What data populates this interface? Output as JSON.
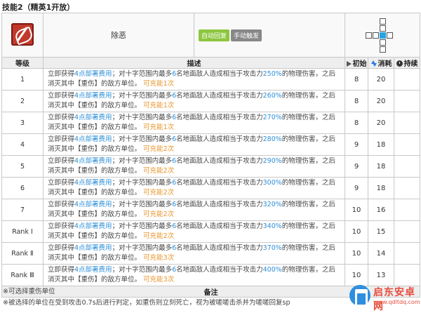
{
  "title": "技能2（精英1开放）",
  "skill": {
    "name": "除恶",
    "tags": [
      "自动回复",
      "手动触发"
    ],
    "colors": {
      "auto_tag": "#8dc63f",
      "manual_tag": "#888888",
      "highlight_blue": "#2f8fd8",
      "highlight_orange": "#e8952d"
    }
  },
  "headers": {
    "level": "等级",
    "desc": "描述",
    "init": "初始",
    "cost": "消耗",
    "dur": "持续"
  },
  "desc_text": {
    "p1": "立即获得",
    "dp": "4点部署费用",
    "p2": "；对十字范围内最多",
    "count": "6",
    "p3": "名地面敌人造成相当于攻击力",
    "p4": "的物理伤害，之后消灭其中【重伤】的敌方单位。",
    "charges_prefix": "可充能"
  },
  "levels": [
    {
      "level": "1",
      "pct": "250%",
      "charges": "1次",
      "init": "8",
      "cost": "20",
      "dur": ""
    },
    {
      "level": "2",
      "pct": "260%",
      "charges": "1次",
      "init": "8",
      "cost": "20",
      "dur": ""
    },
    {
      "level": "3",
      "pct": "270%",
      "charges": "1次",
      "init": "8",
      "cost": "20",
      "dur": ""
    },
    {
      "level": "4",
      "pct": "280%",
      "charges": "2次",
      "init": "9",
      "cost": "18",
      "dur": ""
    },
    {
      "level": "5",
      "pct": "290%",
      "charges": "2次",
      "init": "9",
      "cost": "18",
      "dur": ""
    },
    {
      "level": "6",
      "pct": "300%",
      "charges": "2次",
      "init": "9",
      "cost": "18",
      "dur": ""
    },
    {
      "level": "7",
      "pct": "320%",
      "charges": "2次",
      "init": "10",
      "cost": "16",
      "dur": ""
    },
    {
      "level": "Rank Ⅰ",
      "pct": "340%",
      "charges": "2次",
      "init": "10",
      "cost": "15",
      "dur": ""
    },
    {
      "level": "Rank Ⅱ",
      "pct": "370%",
      "charges": "3次",
      "init": "10",
      "cost": "14",
      "dur": ""
    },
    {
      "level": "Rank Ⅲ",
      "pct": "400%",
      "charges": "3次",
      "init": "10",
      "cost": "13",
      "dur": ""
    }
  ],
  "notes_header": "备注",
  "notes": [
    "※可选择重伤单位",
    "※被选择的单位在受到攻击0.7s后进行判定，如重伤则立刻死亡，视为被嗟嗟击杀并为嗟嗟回复sp"
  ],
  "watermark": {
    "name": "启东安卓网",
    "url": "www.qdltdq.com",
    "icon": "phone-badge-icon"
  }
}
